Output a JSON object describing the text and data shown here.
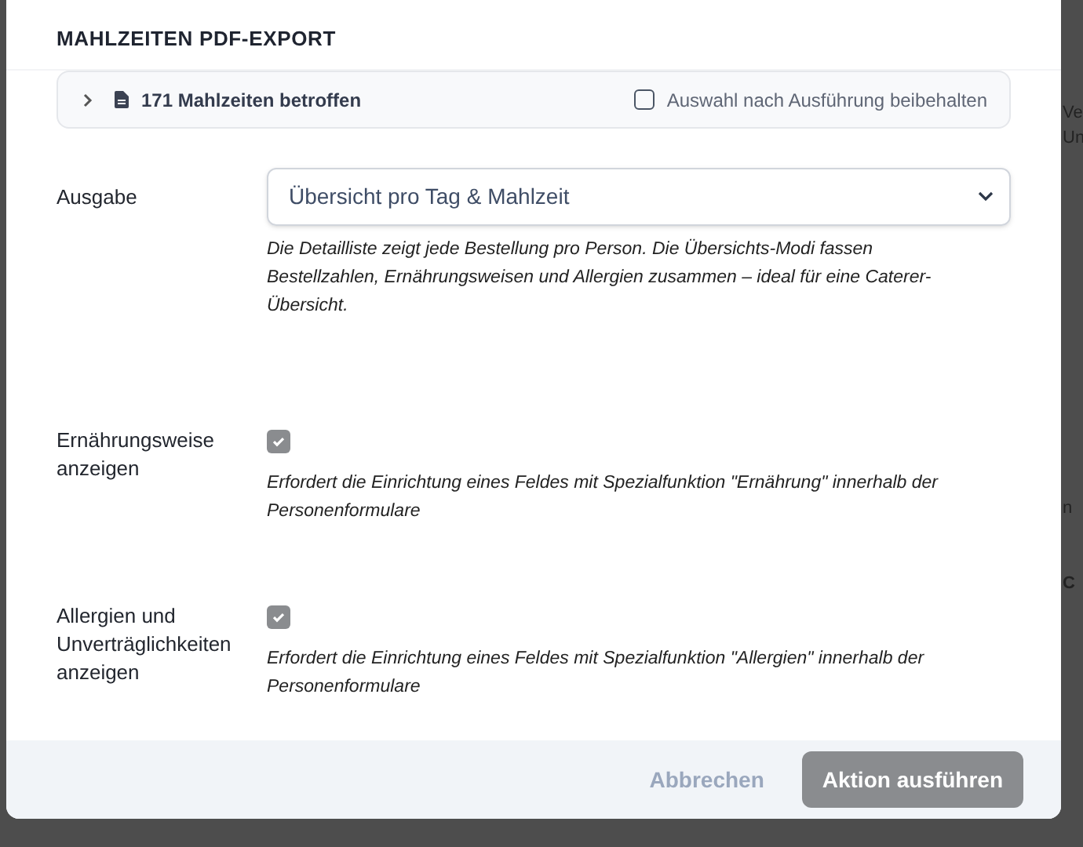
{
  "background_fragments": [
    "Ve",
    "Un",
    "n",
    "C"
  ],
  "dialog": {
    "title": "MAHLZEITEN PDF-EXPORT",
    "summary": {
      "label": "171 Mahlzeiten betroffen",
      "expanded": false,
      "keep_selection": {
        "label": "Auswahl nach Ausführung beibehalten",
        "checked": false
      }
    },
    "fields": [
      {
        "kind": "select",
        "label": "Ausgabe",
        "value": "Übersicht pro Tag & Mahlzeit",
        "help": "Die Detailliste zeigt jede Bestellung pro Person. Die Übersichts-Modi fassen Bestellzahlen, Ernährungsweisen und Allergien zusammen – ideal für eine Caterer-Übersicht."
      },
      {
        "kind": "checkbox",
        "label": "Ernährungsweise anzeigen",
        "checked": true,
        "disabled": true,
        "help": "Erfordert die Einrichtung eines Feldes mit Spezialfunktion \"Ernährung\" innerhalb der Personenformulare"
      },
      {
        "kind": "checkbox",
        "label": "Allergien und Unverträglichkeiten anzeigen",
        "checked": true,
        "disabled": true,
        "help": "Erfordert die Einrichtung eines Feldes mit Spezialfunktion \"Allergien\" innerhalb der Personenformulare"
      }
    ],
    "buttons": [
      {
        "kind": "cancel",
        "label": "Abbrechen"
      },
      {
        "kind": "submit",
        "label": "Aktion ausführen",
        "disabled": true
      }
    ]
  }
}
